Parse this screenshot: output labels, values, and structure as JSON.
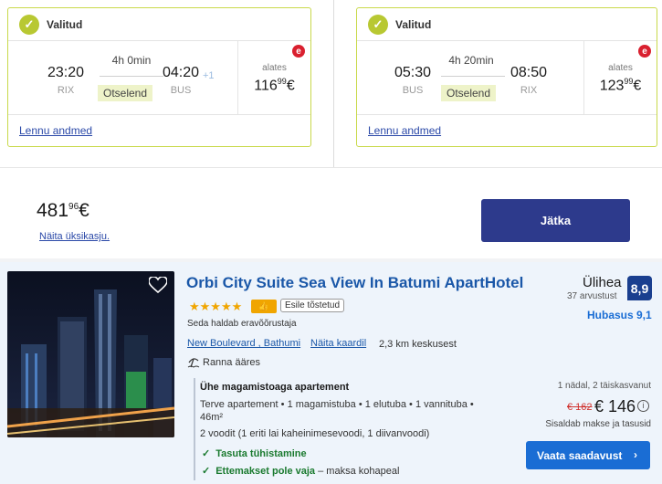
{
  "outbound": {
    "status": "Valitud",
    "dep_time": "23:20",
    "dep_code": "RIX",
    "duration": "4h 0min",
    "direct": "Otselend",
    "arr_time": "04:20",
    "arr_code": "BUS",
    "day_offset": "+1",
    "from_label": "alates",
    "price_main": "116",
    "price_cents": "99",
    "currency": "€",
    "details_link": "Lennu andmed"
  },
  "inbound": {
    "status": "Valitud",
    "dep_time": "05:30",
    "dep_code": "BUS",
    "duration": "4h 20min",
    "direct": "Otselend",
    "arr_time": "08:50",
    "arr_code": "RIX",
    "from_label": "alates",
    "price_main": "123",
    "price_cents": "99",
    "currency": "€",
    "details_link": "Lennu andmed"
  },
  "summary": {
    "total_main": "481",
    "total_cents": "96",
    "currency": "€",
    "single_price_link": "Näita üksikasju.",
    "continue_label": "Jätka"
  },
  "hotel": {
    "name": "Orbi City Suite Sea View In Batumi ApartHotel",
    "stars": "★★★★★",
    "featured_label": "Esile tõstetud",
    "owner_note": "Seda haldab eravõõrustaja",
    "location_link": "New Boulevard , Bathumi",
    "map_link": "Näita kaardil",
    "distance": "2,3 km keskusest",
    "beach": "Ranna ääres",
    "rating_word": "Ülihea",
    "reviews": "37 arvustust",
    "score": "8,9",
    "value_score": "Hubasus 9,1",
    "room_title": "Ühe magamistoaga apartement",
    "room_desc": "Terve apartement • 1 magamistuba • 1 elutuba • 1 vannituba • 46m²",
    "beds": "2 voodit (1 eriti lai kaheinimesevoodi, 1 diivanvoodi)",
    "perk_cancel": "Tasuta tühistamine",
    "perk_prepay": "Ettemakset pole vaja",
    "perk_prepay_sub": " – maksa kohapeal",
    "stay_info": "1 nädal, 2 täiskasvanut",
    "old_price": "€ 162",
    "new_price": "€ 146",
    "taxes_note": "Sisaldab makse ja tasusid",
    "availability_label": "Vaata saadavust"
  },
  "colors": {
    "selected_border": "#c9d94a",
    "primary_button": "#2d3a8c",
    "link_blue": "#1a57a8",
    "score_bg": "#1a3f8f"
  }
}
